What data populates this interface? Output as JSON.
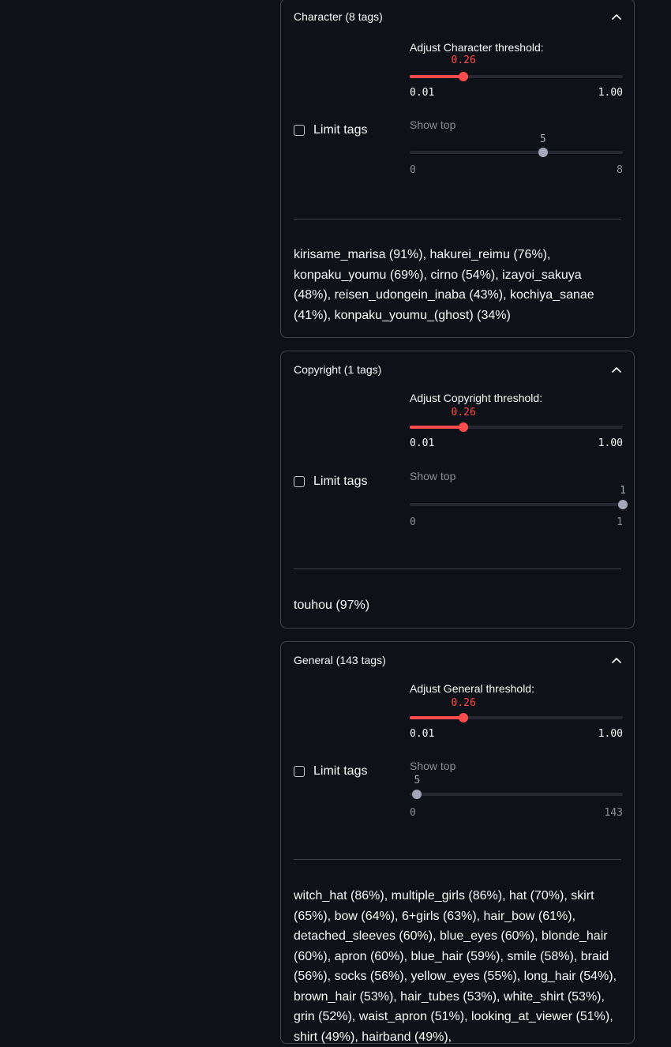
{
  "panels": [
    {
      "title": "Character (8 tags)",
      "limit_label": "Limit tags",
      "threshold": {
        "label": "Adjust Character threshold:",
        "value": 0.26,
        "value_text": "0.26",
        "min_text": "0.01",
        "max_text": "1.00",
        "min": 0.01,
        "max": 1.0
      },
      "show_top": {
        "label": "Show top",
        "value": 5,
        "value_text": "5",
        "min_text": "0",
        "max_text": "8",
        "min": 0,
        "max": 8
      },
      "tags_text": "kirisame_marisa (91%), hakurei_reimu (76%), konpaku_youmu (69%), cirno (54%), izayoi_sakuya (48%), reisen_udongein_inaba (43%), kochiya_sanae (41%), konpaku_youmu_(ghost) (34%)"
    },
    {
      "title": "Copyright (1 tags)",
      "limit_label": "Limit tags",
      "threshold": {
        "label": "Adjust Copyright threshold:",
        "value": 0.26,
        "value_text": "0.26",
        "min_text": "0.01",
        "max_text": "1.00",
        "min": 0.01,
        "max": 1.0
      },
      "show_top": {
        "label": "Show top",
        "value": 1,
        "value_text": "1",
        "min_text": "0",
        "max_text": "1",
        "min": 0,
        "max": 1
      },
      "tags_text": "touhou (97%)"
    },
    {
      "title": "General (143 tags)",
      "limit_label": "Limit tags",
      "threshold": {
        "label": "Adjust General threshold:",
        "value": 0.26,
        "value_text": "0.26",
        "min_text": "0.01",
        "max_text": "1.00",
        "min": 0.01,
        "max": 1.0
      },
      "show_top": {
        "label": "Show top",
        "value": 5,
        "value_text": "5",
        "min_text": "0",
        "max_text": "143",
        "min": 0,
        "max": 143
      },
      "tags_text": "witch_hat (86%), multiple_girls (86%), hat (70%), skirt (65%), bow (64%), 6+girls (63%), hair_bow (61%), detached_sleeves (60%), blue_eyes (60%), blonde_hair (60%), apron (60%), blue_hair (59%), smile (58%), braid (56%), socks (56%), yellow_eyes (55%), long_hair (54%), brown_hair (53%), hair_tubes (53%), white_shirt (53%), grin (52%), waist_apron (51%), looking_at_viewer (51%), shirt (49%), hairband (49%),"
    }
  ],
  "colors": {
    "background": "#0e1117",
    "accent": "#ff4b4b",
    "border": "#41444c",
    "track": "#262730",
    "thumb_inactive": "#a3a8b8"
  }
}
